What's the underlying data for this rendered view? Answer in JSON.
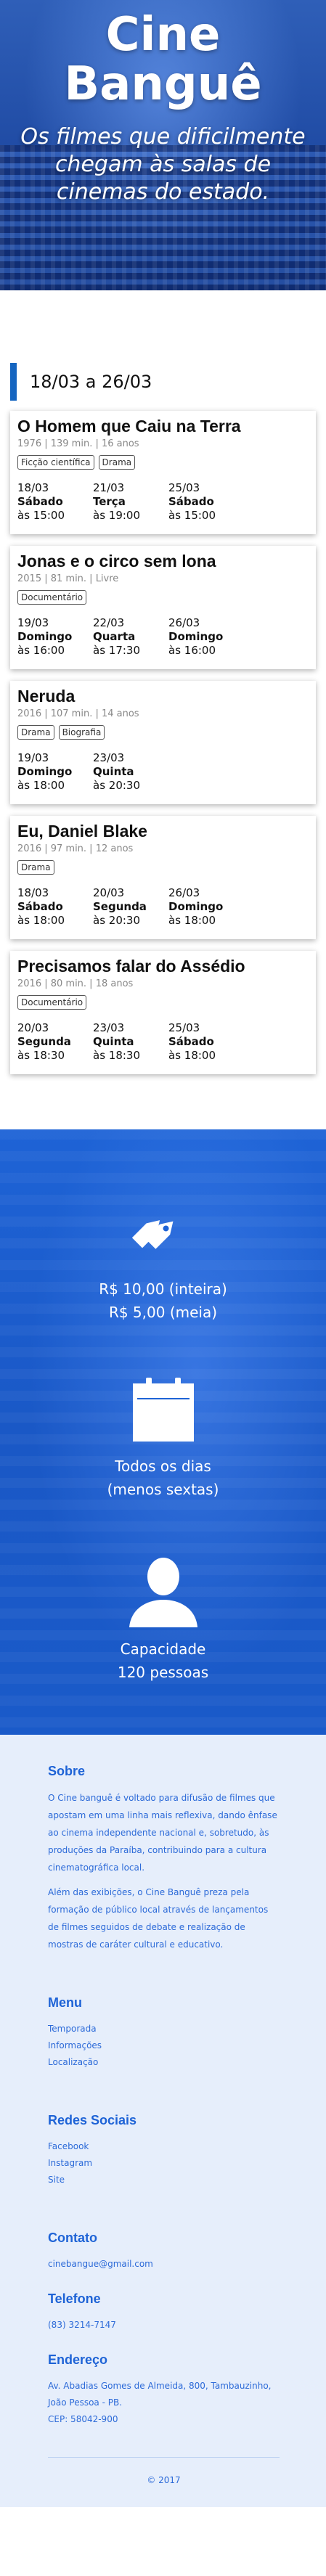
{
  "hero": {
    "title_line1": "Cine",
    "title_line2": "Banguê",
    "tagline": "Os filmes que dificilmente chegam às salas de cinemas do estado."
  },
  "schedule": {
    "week_label": "18/03 a 26/03",
    "movies": [
      {
        "title": "O Homem que Caiu na Terra",
        "meta": "1976 | 139 min. | 16 anos",
        "genres": [
          "Ficção científica",
          "Drama"
        ],
        "sessions": [
          {
            "date": "18/03",
            "day": "Sábado",
            "time": "às 15:00"
          },
          {
            "date": "21/03",
            "day": "Terça",
            "time": "às 19:00"
          },
          {
            "date": "25/03",
            "day": "Sábado",
            "time": "às 15:00"
          }
        ]
      },
      {
        "title": "Jonas e o circo sem lona",
        "meta": "2015 | 81 min. | Livre",
        "genres": [
          "Documentário"
        ],
        "sessions": [
          {
            "date": "19/03",
            "day": "Domingo",
            "time": "às 16:00"
          },
          {
            "date": "22/03",
            "day": "Quarta",
            "time": "às 17:30"
          },
          {
            "date": "26/03",
            "day": "Domingo",
            "time": "às 16:00"
          }
        ]
      },
      {
        "title": "Neruda",
        "meta": "2016 | 107 min. | 14 anos",
        "genres": [
          "Drama",
          "Biografia"
        ],
        "sessions": [
          {
            "date": "19/03",
            "day": "Domingo",
            "time": "às 18:00"
          },
          {
            "date": "23/03",
            "day": "Quinta",
            "time": "às 20:30"
          }
        ]
      },
      {
        "title": "Eu, Daniel Blake",
        "meta": "2016 | 97 min. | 12 anos",
        "genres": [
          "Drama"
        ],
        "sessions": [
          {
            "date": "18/03",
            "day": "Sábado",
            "time": "às 18:00"
          },
          {
            "date": "20/03",
            "day": "Segunda",
            "time": "às 20:30"
          },
          {
            "date": "26/03",
            "day": "Domingo",
            "time": "às 18:00"
          }
        ]
      },
      {
        "title": "Precisamos falar do Assédio",
        "meta": "2016 | 80 min. | 18 anos",
        "genres": [
          "Documentário"
        ],
        "sessions": [
          {
            "date": "20/03",
            "day": "Segunda",
            "time": "às 18:30"
          },
          {
            "date": "23/03",
            "day": "Quinta",
            "time": "às 18:30"
          },
          {
            "date": "25/03",
            "day": "Sábado",
            "time": "às 18:00"
          }
        ]
      }
    ]
  },
  "info": {
    "price": {
      "icon": "price-tag-icon",
      "line1": "R$ 10,00 (inteira)",
      "line2": "R$ 5,00 (meia)"
    },
    "schedule": {
      "icon": "calendar-icon",
      "line1": "Todos os dias",
      "line2": "(menos sextas)"
    },
    "capacity": {
      "icon": "person-icon",
      "line1": "Capacidade",
      "line2": "120 pessoas"
    }
  },
  "footer": {
    "about": {
      "heading": "Sobre",
      "p1": "O Cine banguê é voltado para difusão de filmes que apostam em uma linha mais reflexiva, dando ênfase ao cinema independente nacional e, sobretudo, às produções da Paraíba, contribuindo para a cultura cinematográfica local.",
      "p2": "Além das exibições, o Cine Banguê preza pela formação de público local através de lançamentos de filmes seguidos de debate e realização de mostras de caráter cultural e educativo."
    },
    "menu": {
      "heading": "Menu",
      "items": [
        "Temporada",
        "Informações",
        "Localização"
      ]
    },
    "social": {
      "heading": "Redes Sociais",
      "items": [
        "Facebook",
        "Instagram",
        "Site"
      ]
    },
    "contact": {
      "heading": "Contato",
      "email": "cinebangue@gmail.com"
    },
    "phone": {
      "heading": "Telefone",
      "number": "(83) 3214-7147"
    },
    "address": {
      "heading": "Endereço",
      "line1": "Av. Abadias Gomes de Almeida, 800, Tambauzinho,",
      "line2": "João Pessoa - PB.",
      "line3": "CEP: 58042-900"
    },
    "copyright": "© 2017"
  }
}
